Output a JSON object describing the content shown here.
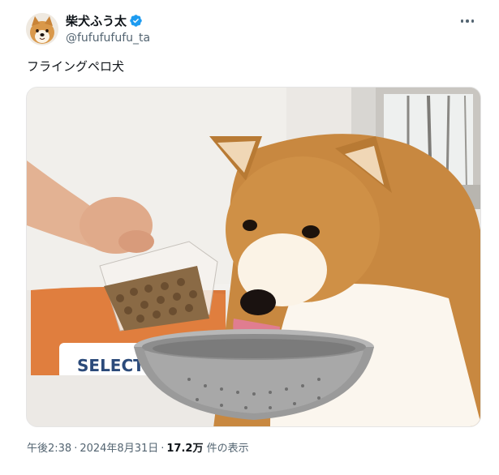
{
  "tweet": {
    "display_name": "柴犬ふう太",
    "handle": "@fufufufufu_ta",
    "verified": true,
    "text": "フライングペロ犬",
    "time": "午後2:38",
    "date": "2024年8月31日",
    "views_count": "17.2万",
    "views_label": "件の表示",
    "separator": "·"
  },
  "media": {
    "kind": "photo",
    "bag_label": "SELECT"
  },
  "icons": {
    "verified": "verified-badge-icon",
    "more": "more-options-icon"
  },
  "colors": {
    "verified_blue": "#1d9bf0",
    "secondary_text": "#536471",
    "primary_text": "#0f1419"
  }
}
